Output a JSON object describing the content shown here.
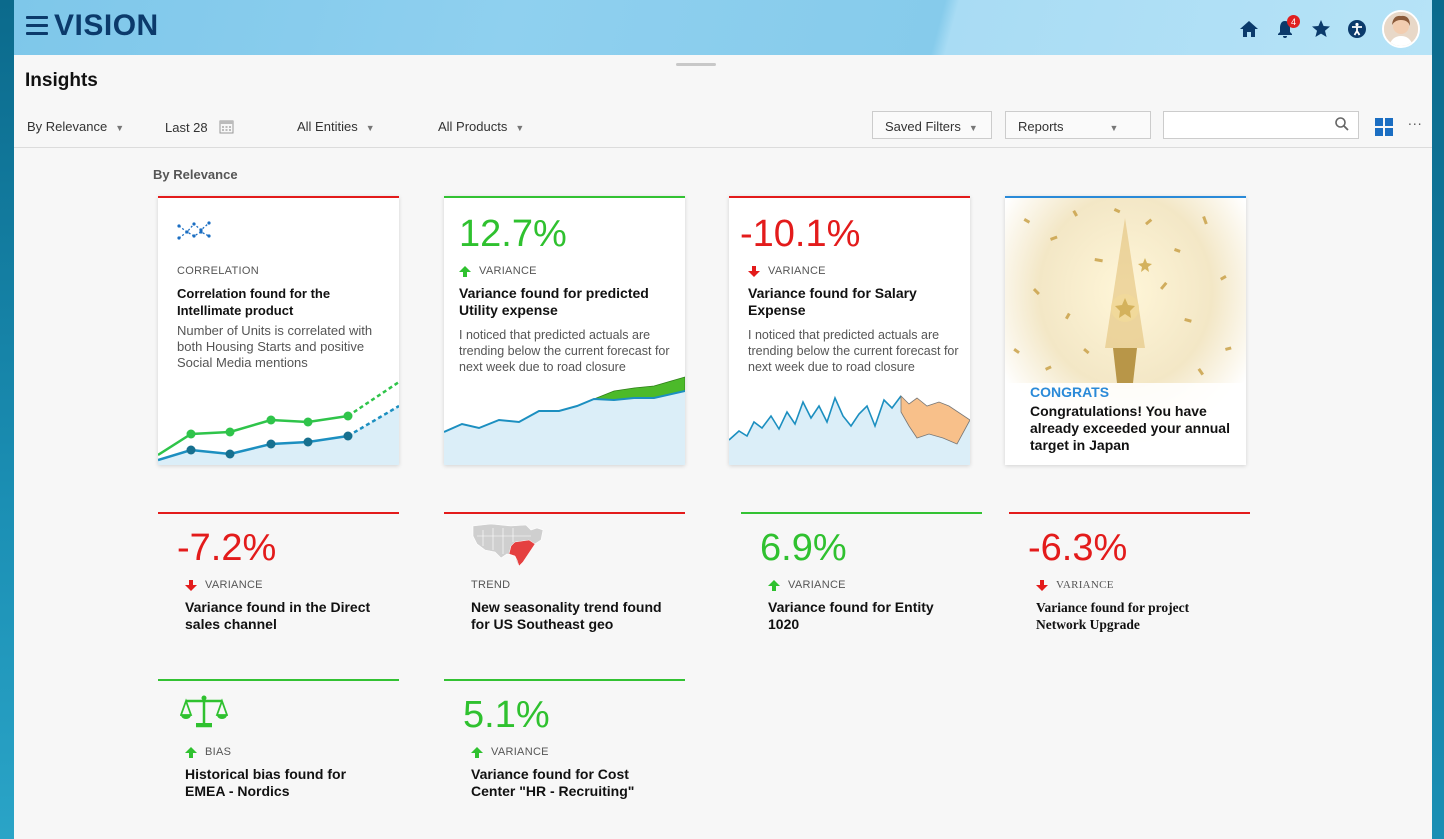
{
  "app": {
    "logo": "VISION",
    "notification_count": "4"
  },
  "page": {
    "title": "Insights",
    "section_label": "By Relevance"
  },
  "toolbar": {
    "sort": "By Relevance",
    "period": "Last 28",
    "entities": "All Entities",
    "products": "All Products",
    "saved_filters": "Saved Filters",
    "reports": "Reports",
    "search_placeholder": "",
    "more": "∙∙∙"
  },
  "header_icons": [
    "home-icon",
    "bell-icon",
    "star-icon",
    "accessibility-icon",
    "avatar"
  ],
  "cards": {
    "correlation": {
      "category": "CORRELATION",
      "title": "Correlation found for the Intellimate product",
      "desc": "Number of Units is correlated with both Housing Starts and positive Social Media mentions"
    },
    "utility": {
      "value": "12.7%",
      "category": "VARIANCE",
      "title": "Variance found for predicted Utility expense",
      "desc": "I noticed that predicted actuals are trending below the current forecast for next week due to road closure"
    },
    "salary": {
      "value": "-10.1%",
      "category": "VARIANCE",
      "title": "Variance found for Salary Expense",
      "desc": "I noticed that predicted actuals are trending below the current forecast for next week due to road closure"
    },
    "congrats": {
      "category": "CONGRATS",
      "title": "Congratulations! You have already exceeded your annual target in Japan"
    },
    "direct": {
      "value": "-7.2%",
      "category": "VARIANCE",
      "title": "Variance found in the Direct sales channel"
    },
    "trend": {
      "category": "TREND",
      "title": "New seasonality trend found for US Southeast geo"
    },
    "entity": {
      "value": "6.9%",
      "category": "VARIANCE",
      "title": "Variance found for Entity 1020"
    },
    "project": {
      "value": "-6.3%",
      "category": "VARIANCE",
      "title": "Variance found for project Network Upgrade"
    },
    "bias": {
      "category": "BIAS",
      "title": "Historical bias found for EMEA - Nordics"
    },
    "cost": {
      "value": "5.1%",
      "category": "VARIANCE",
      "title": "Variance found for Cost Center \"HR - Recruiting\""
    }
  },
  "colors": {
    "accent_blue": "#1b6ec2",
    "negative": "#e31b1b",
    "positive": "#2fc12f",
    "header": "#8fd0ef"
  }
}
